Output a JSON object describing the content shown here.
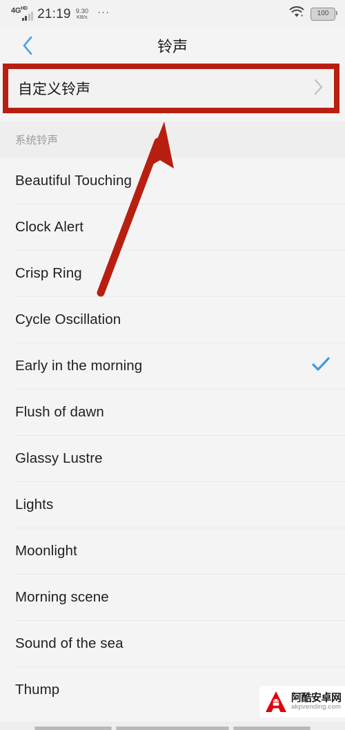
{
  "status_bar": {
    "network_type": "4G",
    "network_type_sup": "HD",
    "time": "21:19",
    "net_speed_value": "9.30",
    "net_speed_unit": "KB/s",
    "more_dots": "···",
    "wifi_icon": "wifi-icon",
    "battery_level": "100"
  },
  "header": {
    "back_label": "‹",
    "title": "铃声"
  },
  "custom_ringtone": {
    "label": "自定义铃声",
    "chevron": "›",
    "highlight_color": "#b81f11"
  },
  "section": {
    "title": "系统铃声"
  },
  "ringtones": [
    {
      "name": "Beautiful Touching",
      "selected": false
    },
    {
      "name": "Clock Alert",
      "selected": false
    },
    {
      "name": "Crisp Ring",
      "selected": false
    },
    {
      "name": "Cycle Oscillation",
      "selected": false
    },
    {
      "name": "Early in the morning",
      "selected": true
    },
    {
      "name": "Flush of dawn",
      "selected": false
    },
    {
      "name": "Glassy Lustre",
      "selected": false
    },
    {
      "name": "Lights",
      "selected": false
    },
    {
      "name": "Moonlight",
      "selected": false
    },
    {
      "name": "Morning scene",
      "selected": false
    },
    {
      "name": "Sound of the sea",
      "selected": false
    },
    {
      "name": "Thump",
      "selected": false
    }
  ],
  "selected_color": "#3d9ae0",
  "annotation": {
    "arrow_color": "#b81f11"
  },
  "watermark": {
    "logo_letter": "A",
    "site_name_cn": "阿酷安卓网",
    "site_url": "akpvending.com",
    "logo_color": "#e2000f"
  }
}
